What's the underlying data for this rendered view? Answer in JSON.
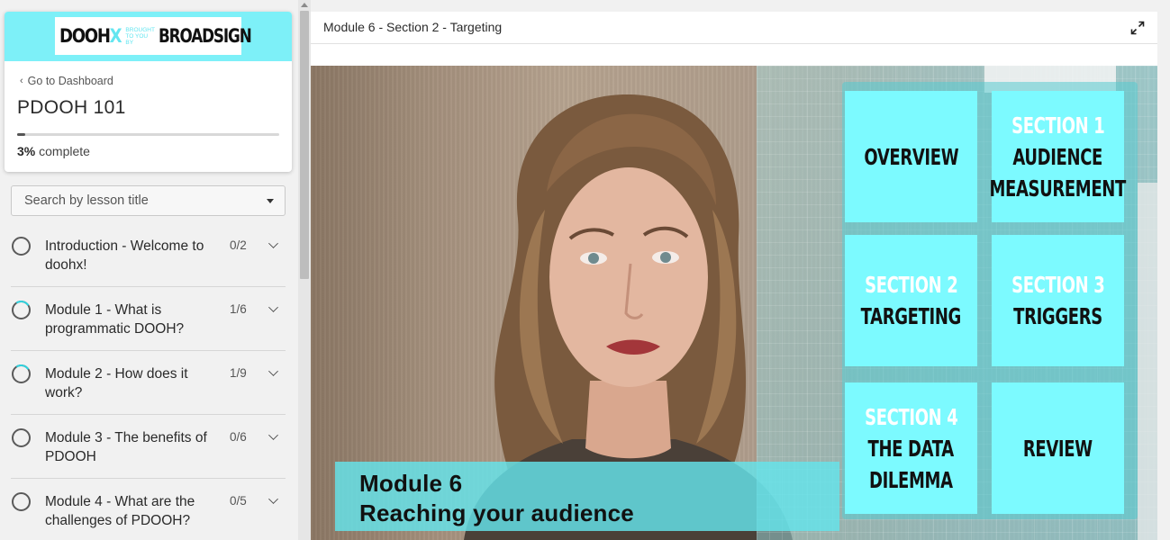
{
  "brand": {
    "logo_main": "DOOH",
    "logo_x": "X",
    "logo_small": "BROUGHT TO YOU BY",
    "logo_partner": "BROADSIGN",
    "accent_color": "#7df0f8"
  },
  "course": {
    "back_label": "Go to Dashboard",
    "title": "PDOOH 101",
    "progress_percent": 3,
    "progress_value": "3%",
    "progress_suffix": "complete"
  },
  "search": {
    "placeholder": "Search by lesson title"
  },
  "lessons": [
    {
      "title": "Introduction - Welcome to doohx!",
      "count": "0/2",
      "state": "empty"
    },
    {
      "title": "Module 1 - What is programmatic DOOH?",
      "count": "1/6",
      "state": "partial"
    },
    {
      "title": "Module 2 - How does it work?",
      "count": "1/9",
      "state": "partial"
    },
    {
      "title": "Module 3 - The benefits of PDOOH",
      "count": "0/6",
      "state": "empty"
    },
    {
      "title": "Module 4 - What are the challenges of PDOOH?",
      "count": "0/5",
      "state": "empty"
    }
  ],
  "player": {
    "title": "Module 6 - Section 2 - Targeting",
    "expand_icon": "expand-icon"
  },
  "video": {
    "tiles": [
      {
        "section": "",
        "lines": [
          "OVERVIEW"
        ]
      },
      {
        "section": "SECTION 1",
        "lines": [
          "AUDIENCE",
          "MEASUREMENT"
        ]
      },
      {
        "section": "SECTION 2",
        "lines": [
          "TARGETING"
        ]
      },
      {
        "section": "SECTION 3",
        "lines": [
          "TRIGGERS"
        ]
      },
      {
        "section": "SECTION 4",
        "lines": [
          "THE DATA",
          "DILEMMA"
        ]
      },
      {
        "section": "",
        "lines": [
          "REVIEW"
        ]
      }
    ],
    "caption_line1": "Module 6",
    "caption_line2": "Reaching your audience"
  }
}
